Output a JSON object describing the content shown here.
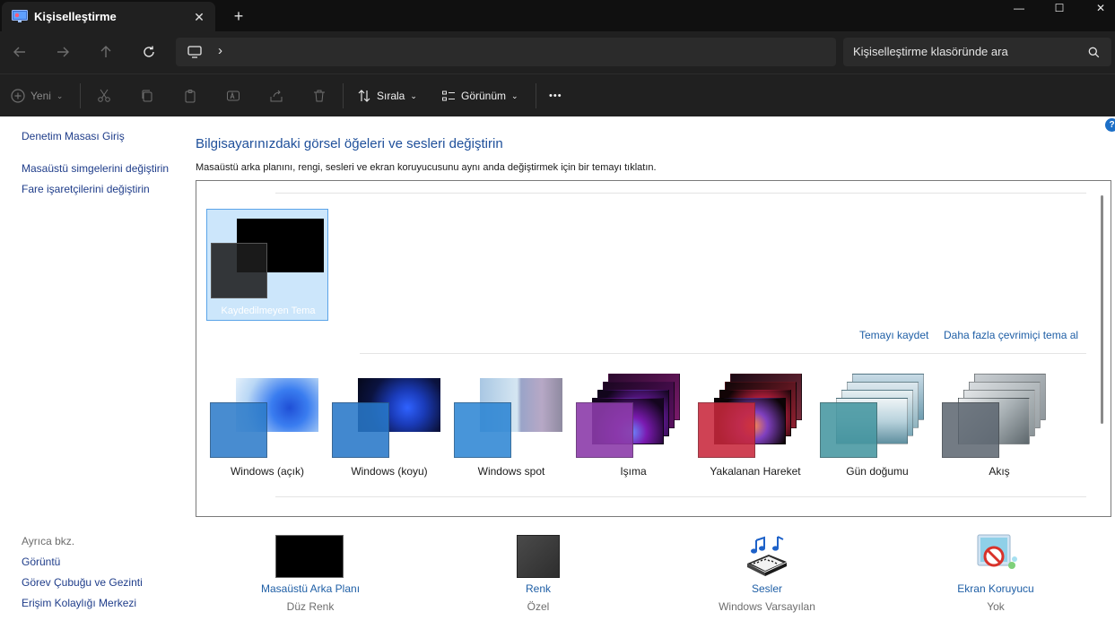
{
  "window": {
    "tab_title": "Kişiselleştirme",
    "close_tab": "✕",
    "new_tab": "+",
    "minimize": "—",
    "maximize": "☐",
    "close": "✕"
  },
  "address": {
    "breadcrumb_separator": "›",
    "search_placeholder": "Kişiselleştirme klasöründe ara"
  },
  "toolbar": {
    "new_label": "Yeni",
    "sort_label": "Sırala",
    "view_label": "Görünüm",
    "more_label": "•••"
  },
  "left_nav": {
    "home": "Denetim Masası Giriş",
    "desktop_icons": "Masaüstü simgelerini değiştirin",
    "mouse_pointers": "Fare işaretçilerini değiştirin",
    "see_also": "Ayrıca bkz.",
    "see_also_items": [
      "Görüntü",
      "Görev Çubuğu ve Gezinti",
      "Erişim Kolaylığı Merkezi"
    ]
  },
  "main": {
    "title": "Bilgisayarınızdaki görsel öğeleri ve sesleri değiştirin",
    "description": "Masaüstü arka planını, rengi, sesleri ve ekran koruyucusunu aynı anda değiştirmek için bir temayı tıklatın.",
    "unsaved_theme": "Kaydedilmeyen Tema",
    "save_theme": "Temayı kaydet",
    "more_online": "Daha fazla çevrimiçi tema al",
    "themes": [
      {
        "label": "Windows (açık)"
      },
      {
        "label": "Windows (koyu)"
      },
      {
        "label": "Windows spot"
      },
      {
        "label": "Işıma"
      },
      {
        "label": "Yakalanan Hareket"
      },
      {
        "label": "Gün doğumu"
      },
      {
        "label": "Akış"
      }
    ]
  },
  "bottom": {
    "background": {
      "label": "Masaüstü Arka Planı",
      "value": "Düz Renk"
    },
    "color": {
      "label": "Renk",
      "value": "Özel"
    },
    "sounds": {
      "label": "Sesler",
      "value": "Windows Varsayılan"
    },
    "screensaver": {
      "label": "Ekran Koruyucu",
      "value": "Yok"
    }
  },
  "colors": {
    "accent_link": "#1f5fa6",
    "selection_bg": "#cce6fb",
    "dark_chrome": "#202020"
  }
}
